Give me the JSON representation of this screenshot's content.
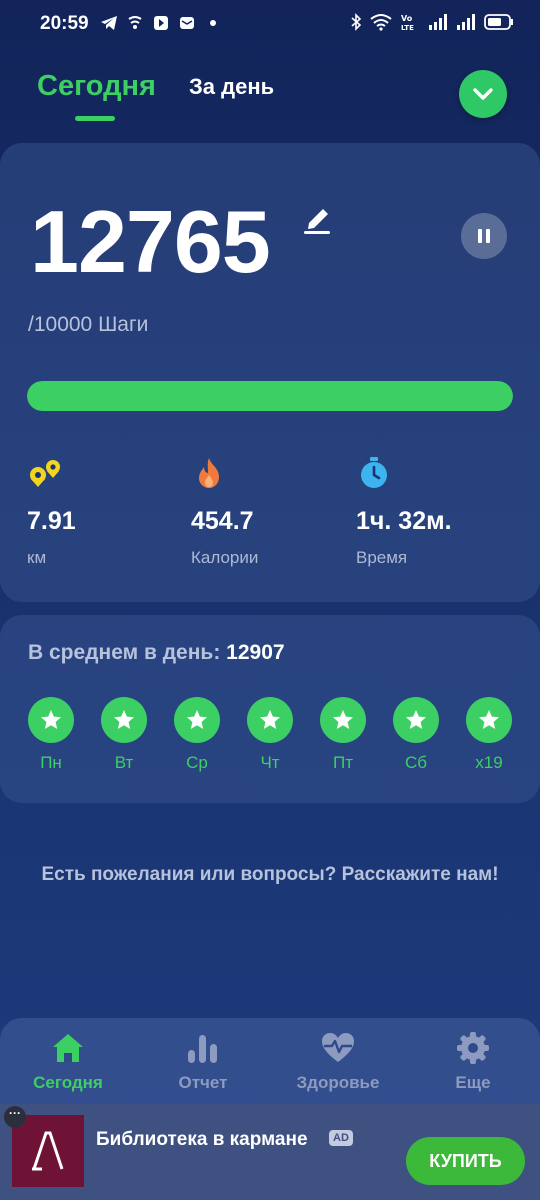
{
  "status_bar": {
    "time": "20:59",
    "left_icons": [
      "telegram-icon",
      "wifi-calling-icon",
      "app-icon",
      "mail-icon",
      "dot-icon"
    ],
    "right_icons": [
      "bluetooth-icon",
      "wifi-icon",
      "volte-icon",
      "signal-icon",
      "signal-icon",
      "battery-icon"
    ]
  },
  "header": {
    "tab_today": "Сегодня",
    "tab_day": "За день",
    "dropdown_icon": "chevron-down-icon"
  },
  "steps": {
    "value": "12765",
    "goal": "/10000 Шаги",
    "progress_fraction": 1.0
  },
  "stats": [
    {
      "icon": "distance-icon",
      "value": "7.91",
      "label": "км",
      "color": "#f2d51f"
    },
    {
      "icon": "flame-icon",
      "value": "454.7",
      "label": "Калории",
      "color": "#f07a3c"
    },
    {
      "icon": "stopwatch-icon",
      "value": "1ч. 32м.",
      "label": "Время",
      "color": "#3db3ef"
    }
  ],
  "streak": {
    "avg_label": "В среднем в день:",
    "avg_value": "12907",
    "days": [
      "Пн",
      "Вт",
      "Ср",
      "Чт",
      "Пт",
      "Сб",
      "x19"
    ]
  },
  "feedback": "Есть пожелания или вопросы? Расскажите нам!",
  "nav": {
    "items": [
      {
        "icon": "home-icon",
        "label": "Сегодня"
      },
      {
        "icon": "report-icon",
        "label": "Отчет"
      },
      {
        "icon": "health-icon",
        "label": "Здоровье"
      },
      {
        "icon": "gear-icon",
        "label": "Еще"
      }
    ]
  },
  "ad": {
    "title": "Библиотека в кармане",
    "badge": "AD",
    "buy": "КУПИТЬ"
  },
  "colors": {
    "accent": "#3ccf63",
    "background": "#1a3470"
  }
}
